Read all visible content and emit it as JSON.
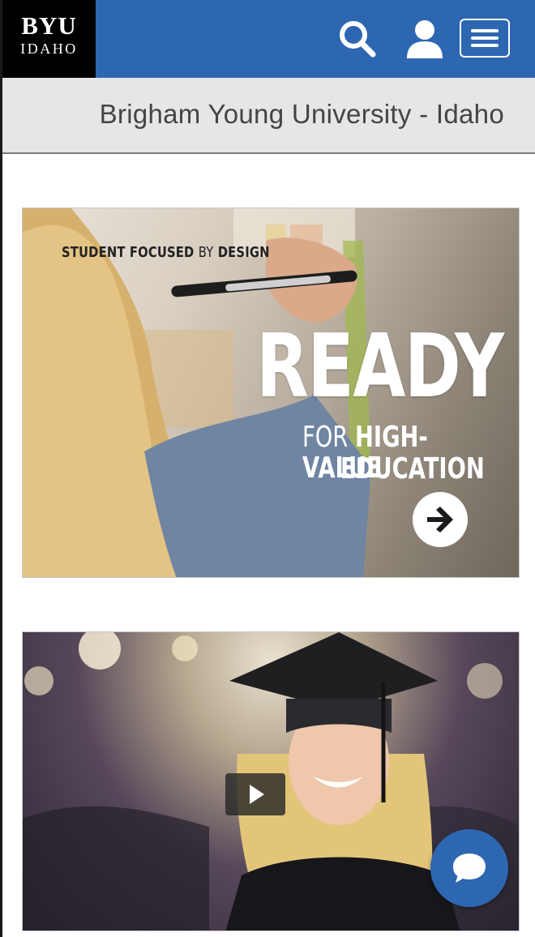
{
  "header": {
    "logo_top": "BYU",
    "logo_bottom": "IDAHO",
    "icons": [
      "search-icon",
      "user-icon",
      "menu-icon"
    ]
  },
  "site": {
    "title": "Brigham Young University - Idaho"
  },
  "hero": {
    "tag_bold1": "STUDENT FOCUSED",
    "tag_thin": "BY",
    "tag_bold2": "DESIGN",
    "headline": "READY",
    "sub_line1_thin": "FOR",
    "sub_line1_bold": "HIGH-VALUE",
    "sub_line2": "EDUCATION",
    "arrow_icon": "arrow-right-icon"
  },
  "video_card": {
    "play_icon": "play-icon"
  },
  "chat": {
    "icon": "chat-bubble-icon"
  },
  "colors": {
    "brand_blue": "#2e67b1",
    "logo_bg": "#000000",
    "title_bar": "#e6e6e6"
  }
}
